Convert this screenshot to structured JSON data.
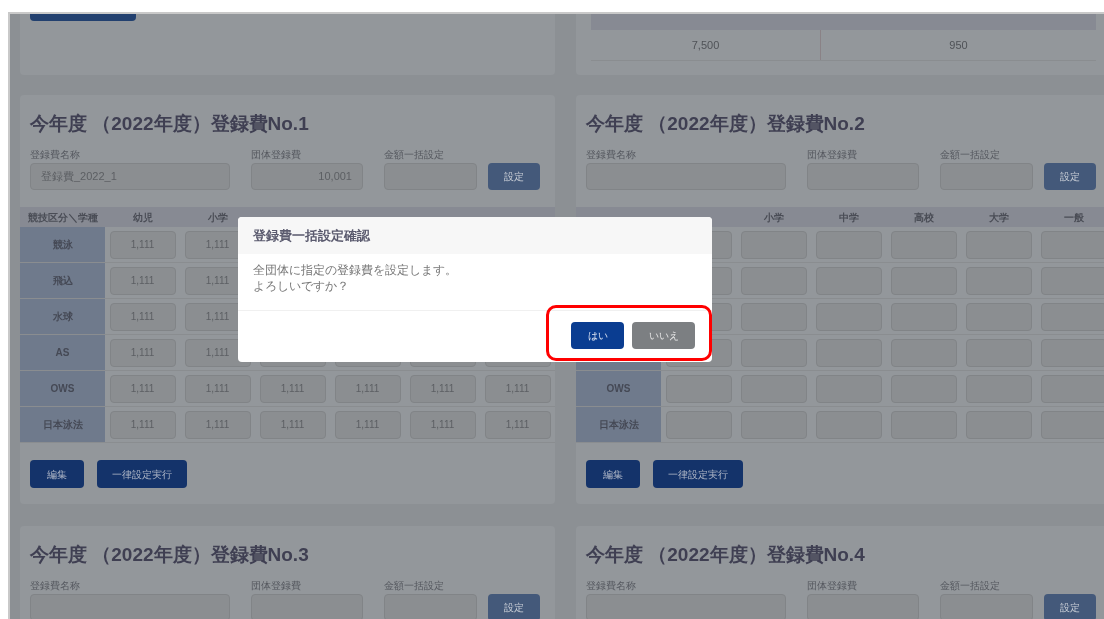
{
  "top_cards": [
    {
      "kind": "button_stub"
    },
    {
      "kind": "fee_table",
      "values": [
        "7,500",
        "950"
      ]
    }
  ],
  "cards": [
    {
      "title": "今年度 （2022年度）登録費No.1",
      "name_label": "登録費名称",
      "name_value": "登録費_2022_1",
      "group_fee_label": "団体登録費",
      "group_fee_value": "10,001",
      "lump_label": "金額一括設定",
      "set_button": "設定",
      "table": {
        "columns": [
          "競技区分＼学種",
          "幼児",
          "小学"
        ],
        "rows": [
          {
            "label": "競泳",
            "values": [
              "1,111",
              "1,111"
            ]
          },
          {
            "label": "飛込",
            "values": [
              "1,111",
              "1,111"
            ]
          },
          {
            "label": "水球",
            "values": [
              "1,111",
              "1,111"
            ]
          },
          {
            "label": "AS",
            "values": [
              "1,111",
              "1,111"
            ]
          },
          {
            "label": "OWS",
            "values": [
              "1,111",
              "1,111",
              "1,111",
              "1,111",
              "1,111",
              "1,111"
            ]
          },
          {
            "label": "日本泳法",
            "values": [
              "1,111",
              "1,111",
              "1,111",
              "1,111",
              "1,111",
              "1,111"
            ]
          }
        ]
      },
      "buttons": [
        "編集",
        "一律設定実行"
      ]
    },
    {
      "title": "今年度 （2022年度）登録費No.2",
      "name_label": "登録費名称",
      "group_fee_label": "団体登録費",
      "lump_label": "金額一括設定",
      "set_button": "設定",
      "table": {
        "columns": [
          null,
          null,
          "小学",
          "中学",
          "高校",
          "大学",
          "一般"
        ],
        "rows": [
          {
            "label": null
          },
          {
            "label": null
          },
          {
            "label": null
          },
          {
            "label": null
          },
          {
            "label": "OWS"
          },
          {
            "label": "日本泳法"
          }
        ]
      },
      "buttons": [
        "編集",
        "一律設定実行"
      ]
    },
    {
      "title": "今年度 （2022年度）登録費No.3",
      "name_label": "登録費名称",
      "group_fee_label": "団体登録費",
      "lump_label": "金額一括設定",
      "set_button": "設定"
    },
    {
      "title": "今年度 （2022年度）登録費No.4",
      "name_label": "登録費名称",
      "group_fee_label": "団体登録費",
      "lump_label": "金額一括設定",
      "set_button": "設定"
    }
  ],
  "dialog": {
    "title": "登録費一括設定確認",
    "message": [
      "全団体に指定の登録費を設定します。",
      "よろしいですか？"
    ],
    "buttons": [
      {
        "label": "はい",
        "kind": "primary"
      },
      {
        "label": "いいえ",
        "kind": "secondary"
      }
    ],
    "highlighted": true
  }
}
